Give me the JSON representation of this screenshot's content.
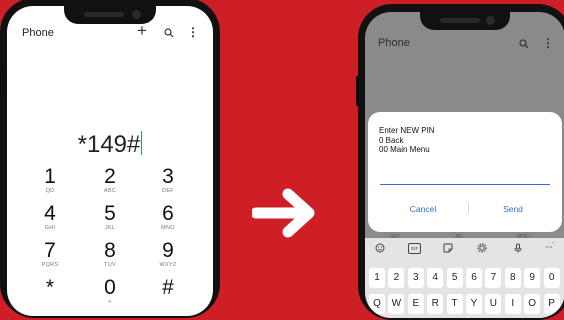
{
  "left_phone": {
    "app_title": "Phone",
    "header_icons": {
      "add": "+",
      "search": "search-icon",
      "more": "⋮"
    },
    "dial_input": "*149#",
    "keypad": [
      {
        "digit": "1",
        "sub": "QD"
      },
      {
        "digit": "2",
        "sub": "ABC"
      },
      {
        "digit": "3",
        "sub": "DEF"
      },
      {
        "digit": "4",
        "sub": "GHI"
      },
      {
        "digit": "5",
        "sub": "JKL"
      },
      {
        "digit": "6",
        "sub": "MNO"
      },
      {
        "digit": "7",
        "sub": "PQRS"
      },
      {
        "digit": "8",
        "sub": "TUV"
      },
      {
        "digit": "9",
        "sub": "WXYZ"
      },
      {
        "digit": "*",
        "sub": ""
      },
      {
        "digit": "0",
        "sub": "+"
      },
      {
        "digit": "#",
        "sub": ""
      }
    ]
  },
  "arrow": "arrow-right-icon",
  "right_phone": {
    "app_title": "Phone",
    "header_icons": {
      "search": "search-icon",
      "more": "⋮"
    },
    "dialog": {
      "lines": [
        "Enter NEW PIN",
        "0 Back",
        "00 Main Menu"
      ],
      "input_value": "",
      "cancel_label": "Cancel",
      "send_label": "Send"
    },
    "peek_labels": [
      "GHI",
      "JKL",
      "MNO"
    ],
    "keyboard": {
      "toolbar_icons": [
        "emoji-icon",
        "gif-icon",
        "sticker-icon",
        "settings-icon",
        "mic-icon",
        "more-icon"
      ],
      "toolbar_gif_label": "GIF",
      "number_row": [
        "1",
        "2",
        "3",
        "4",
        "5",
        "6",
        "7",
        "8",
        "9",
        "0"
      ],
      "letter_row": [
        "Q",
        "W",
        "E",
        "R",
        "T",
        "Y",
        "U",
        "I",
        "O",
        "P"
      ]
    }
  },
  "colors": {
    "background": "#cf1f26",
    "accent_blue": "#2f6fd6",
    "dim_overlay": "#8a8a8a"
  }
}
